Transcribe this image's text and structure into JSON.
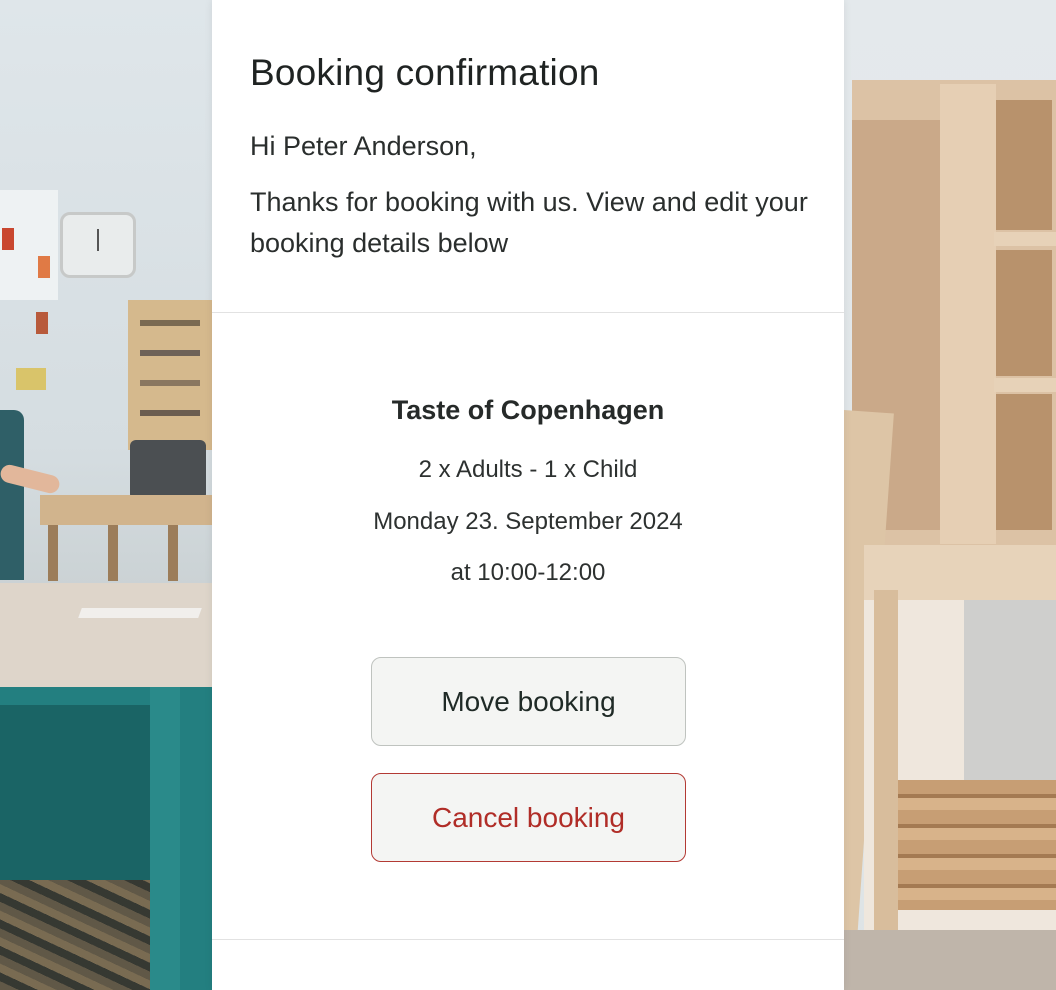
{
  "header": {
    "title": "Booking confirmation",
    "greeting": "Hi Peter Anderson,",
    "intro": "Thanks for booking with us. View and edit your booking details below"
  },
  "booking": {
    "event_name": "Taste of Copenhagen",
    "guests": "2 x Adults - 1 x Child",
    "date": "Monday 23. September 2024",
    "time": "at 10:00-12:00"
  },
  "actions": {
    "move_label": "Move booking",
    "cancel_label": "Cancel booking"
  },
  "colors": {
    "card_background": "#ffffff",
    "button_background": "#f4f5f3",
    "cancel_accent": "#b02d27",
    "move_border": "#bfc3bf",
    "text": "#1f2322"
  }
}
